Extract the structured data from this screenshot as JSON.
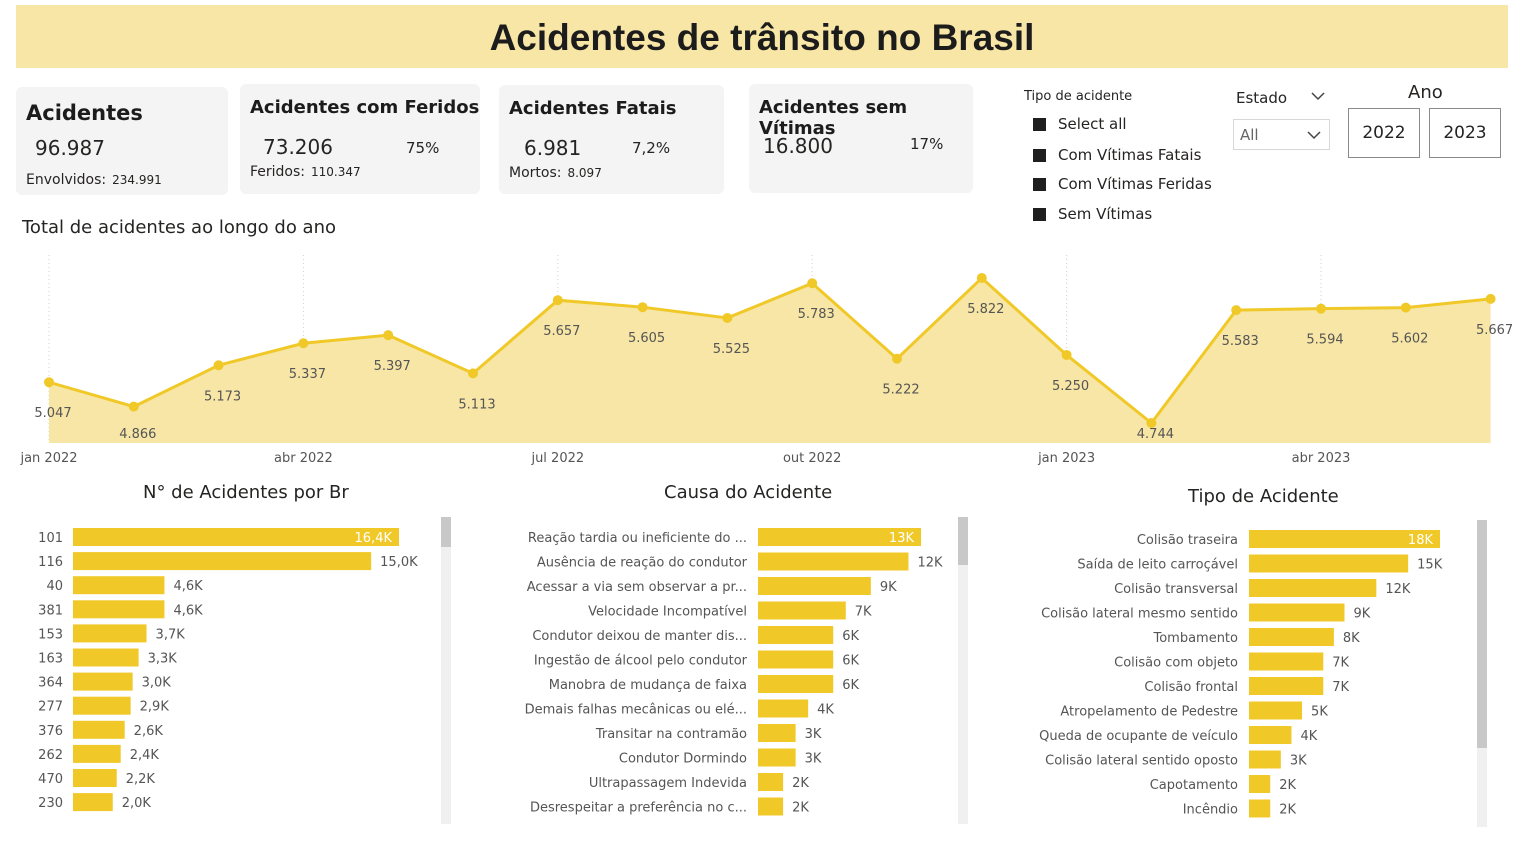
{
  "title": "Acidentes de trânsito no Brasil",
  "colors": {
    "accent": "#f0c929",
    "area": "#f7e6a6",
    "banner": "#f7e6a6"
  },
  "cards": {
    "acidentes": {
      "title": "Acidentes",
      "value": "96.987",
      "sub_label": "Envolvidos:",
      "sub_value": "234.991"
    },
    "feridos": {
      "title": "Acidentes com Feridos",
      "value": "73.206",
      "pct": "75%",
      "sub_label": "Feridos:",
      "sub_value": "110.347"
    },
    "fatais": {
      "title": "Acidentes Fatais",
      "value": "6.981",
      "pct": "7,2%",
      "sub_label": "Mortos:",
      "sub_value": "8.097"
    },
    "sem_vitimas": {
      "title": "Acidentes sem Vítimas",
      "value": "16.800",
      "pct": "17%"
    }
  },
  "slicers": {
    "tipo": {
      "title": "Tipo de acidente",
      "options": [
        "Select all",
        "Com Vítimas Fatais",
        "Com Vítimas Feridas",
        "Sem Vítimas"
      ]
    },
    "estado": {
      "title": "Estado",
      "selected": "All"
    },
    "ano": {
      "title": "Ano",
      "options": [
        "2022",
        "2023"
      ]
    }
  },
  "sections": {
    "line": "Total de acidentes ao longo do ano",
    "br": "N° de Acidentes por Br",
    "causa": "Causa do Acidente",
    "tipo": "Tipo de Acidente"
  },
  "chart_data": [
    {
      "type": "area",
      "title": "Total de acidentes ao longo do ano",
      "x": [
        "2022-01",
        "2022-02",
        "2022-03",
        "2022-04",
        "2022-05",
        "2022-06",
        "2022-07",
        "2022-08",
        "2022-09",
        "2022-10",
        "2022-11",
        "2022-12",
        "2023-01",
        "2023-02",
        "2023-03",
        "2023-04",
        "2023-05",
        "2023-06"
      ],
      "values": [
        5047,
        4866,
        5173,
        5337,
        5397,
        5113,
        5657,
        5605,
        5525,
        5783,
        5222,
        5822,
        5250,
        4744,
        5583,
        5594,
        5602,
        5667
      ],
      "labels": [
        "5.047",
        "4.866",
        "5.173",
        "5.337",
        "5.397",
        "5.113",
        "5.657",
        "5.605",
        "5.525",
        "5.783",
        "5.222",
        "5.822",
        "5.250",
        "4.744",
        "5.583",
        "5.594",
        "5.602",
        "5.667"
      ],
      "x_ticks": [
        "jan 2022",
        "abr 2022",
        "jul 2022",
        "out 2022",
        "jan 2023",
        "abr 2023"
      ],
      "x_tick_index": [
        0,
        3,
        6,
        9,
        12,
        15
      ],
      "grid": "vertical dotted"
    },
    {
      "type": "bar",
      "title": "N° de Acidentes por Br",
      "categories": [
        "101",
        "116",
        "40",
        "381",
        "153",
        "163",
        "364",
        "277",
        "376",
        "262",
        "470",
        "230"
      ],
      "values": [
        16400,
        15000,
        4600,
        4600,
        3700,
        3300,
        3000,
        2900,
        2600,
        2400,
        2200,
        2000
      ],
      "labels": [
        "16,4K",
        "15,0K",
        "4,6K",
        "4,6K",
        "3,7K",
        "3,3K",
        "3,0K",
        "2,9K",
        "2,6K",
        "2,4K",
        "2,2K",
        "2,0K"
      ]
    },
    {
      "type": "bar",
      "title": "Causa do Acidente",
      "categories": [
        "Reação tardia ou ineficiente do ...",
        "Ausência de reação do condutor",
        "Acessar a via sem observar a pr...",
        "Velocidade Incompatível",
        "Condutor deixou de manter dis...",
        "Ingestão de álcool pelo condutor",
        "Manobra de mudança de faixa",
        "Demais falhas mecânicas ou elé...",
        "Transitar na contramão",
        "Condutor Dormindo",
        "Ultrapassagem Indevida",
        "Desrespeitar a preferência no c..."
      ],
      "values": [
        13000,
        12000,
        9000,
        7000,
        6000,
        6000,
        6000,
        4000,
        3000,
        3000,
        2000,
        2000
      ],
      "labels": [
        "13K",
        "12K",
        "9K",
        "7K",
        "6K",
        "6K",
        "6K",
        "4K",
        "3K",
        "3K",
        "2K",
        "2K"
      ]
    },
    {
      "type": "bar",
      "title": "Tipo de Acidente",
      "categories": [
        "Colisão traseira",
        "Saída de leito carroçável",
        "Colisão transversal",
        "Colisão lateral mesmo sentido",
        "Tombamento",
        "Colisão com objeto",
        "Colisão frontal",
        "Atropelamento de Pedestre",
        "Queda de ocupante de veículo",
        "Colisão lateral sentido oposto",
        "Capotamento",
        "Incêndio"
      ],
      "values": [
        18000,
        15000,
        12000,
        9000,
        8000,
        7000,
        7000,
        5000,
        4000,
        3000,
        2000,
        2000
      ],
      "labels": [
        "18K",
        "15K",
        "12K",
        "9K",
        "8K",
        "7K",
        "7K",
        "5K",
        "4K",
        "3K",
        "2K",
        "2K"
      ]
    }
  ]
}
